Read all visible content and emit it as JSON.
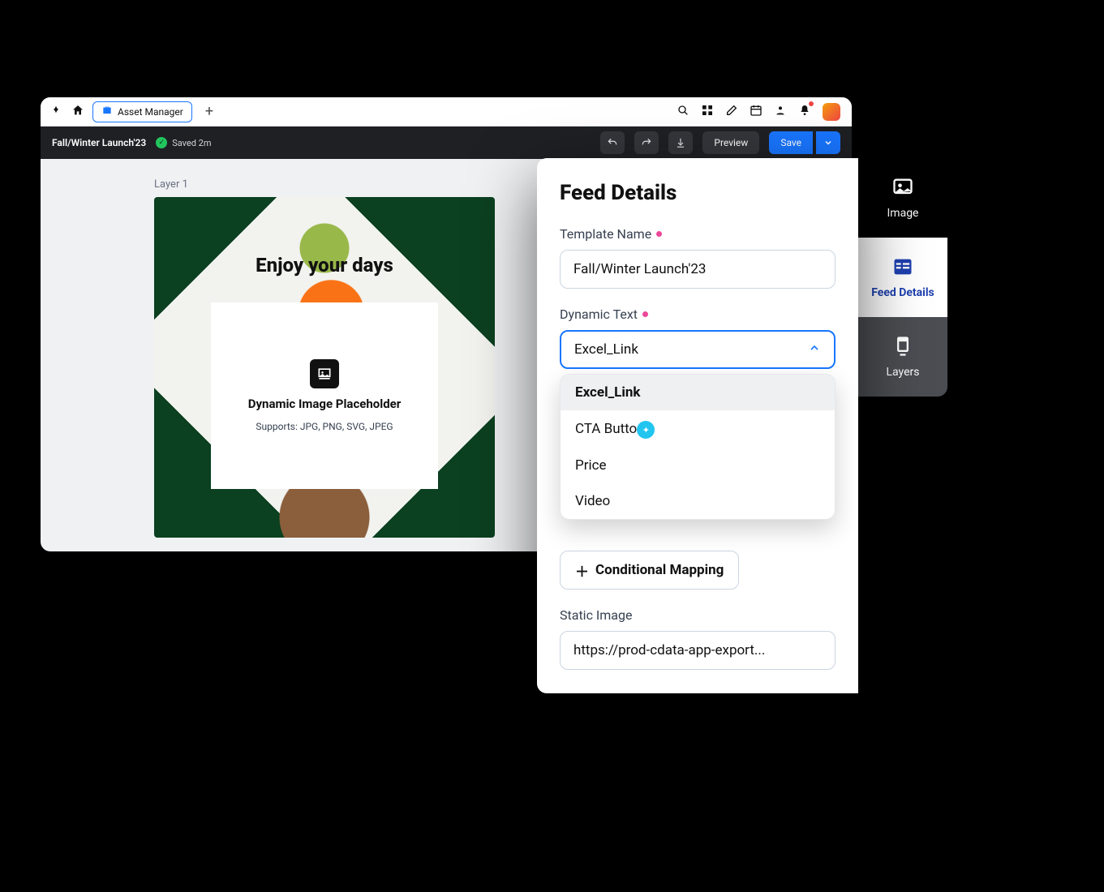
{
  "titlebar": {
    "tab_label": "Asset Manager",
    "plus": "+"
  },
  "toolbar": {
    "project_name": "Fall/Winter Launch'23",
    "saved_text": "Saved 2m",
    "preview_label": "Preview",
    "save_label": "Save"
  },
  "workspace": {
    "layer_label": "Layer 1",
    "canvas_heading": "Enjoy your days",
    "placeholder_title": "Dynamic Image Placeholder",
    "placeholder_sub": "Supports: JPG, PNG, SVG, JPEG"
  },
  "rail": {
    "image": "Image",
    "feed": "Feed Details",
    "layers": "Layers"
  },
  "feed": {
    "title": "Feed Details",
    "template_label": "Template Name",
    "template_value": "Fall/Winter Launch'23",
    "dynamic_label": "Dynamic Text",
    "dynamic_value": "Excel_Link",
    "options": [
      "Excel_Link",
      "CTA Buttons",
      "Price",
      "Video"
    ],
    "cond_label": "Conditional Mapping",
    "static_label": "Static Image",
    "static_value": "https://prod-cdata-app-export..."
  },
  "colors": {
    "accent": "#1976ff",
    "required": "#ec4899"
  }
}
